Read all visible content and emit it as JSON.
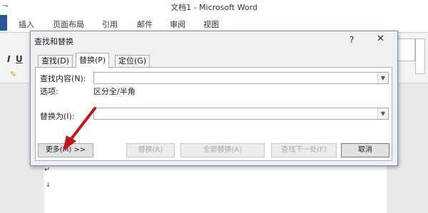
{
  "window": {
    "title": "文档1 - Microsoft Word",
    "qat_symbol": "⇁"
  },
  "ribbon_tabs": [
    "插入",
    "页面布局",
    "引用",
    "邮件",
    "审阅",
    "视图"
  ],
  "ribbon": {
    "fragment_i": "I",
    "fragment_u": "U",
    "fragment_right": "b"
  },
  "dialog": {
    "title": "查找和替换",
    "help": "?",
    "close": "✕",
    "tabs": [
      "查找(D)",
      "替换(P)",
      "定位(G)"
    ],
    "active_tab": "替换(P)",
    "find_label": "查找内容(N):",
    "find_value": "",
    "options_label": "选项:",
    "options_value": "区分全/半角",
    "replace_label": "替换为(I):",
    "replace_value": "",
    "buttons": {
      "more": "更多(M) >>",
      "replace": "替换(R)",
      "replace_all": "全部替换(A)",
      "find_next": "查找下一处(F)",
      "cancel": "取消"
    }
  },
  "document": {
    "paragraph_mark": "↵",
    "paragraph_mark_2": "↓"
  },
  "annotation": {
    "arrow_color": "#c0161b"
  }
}
